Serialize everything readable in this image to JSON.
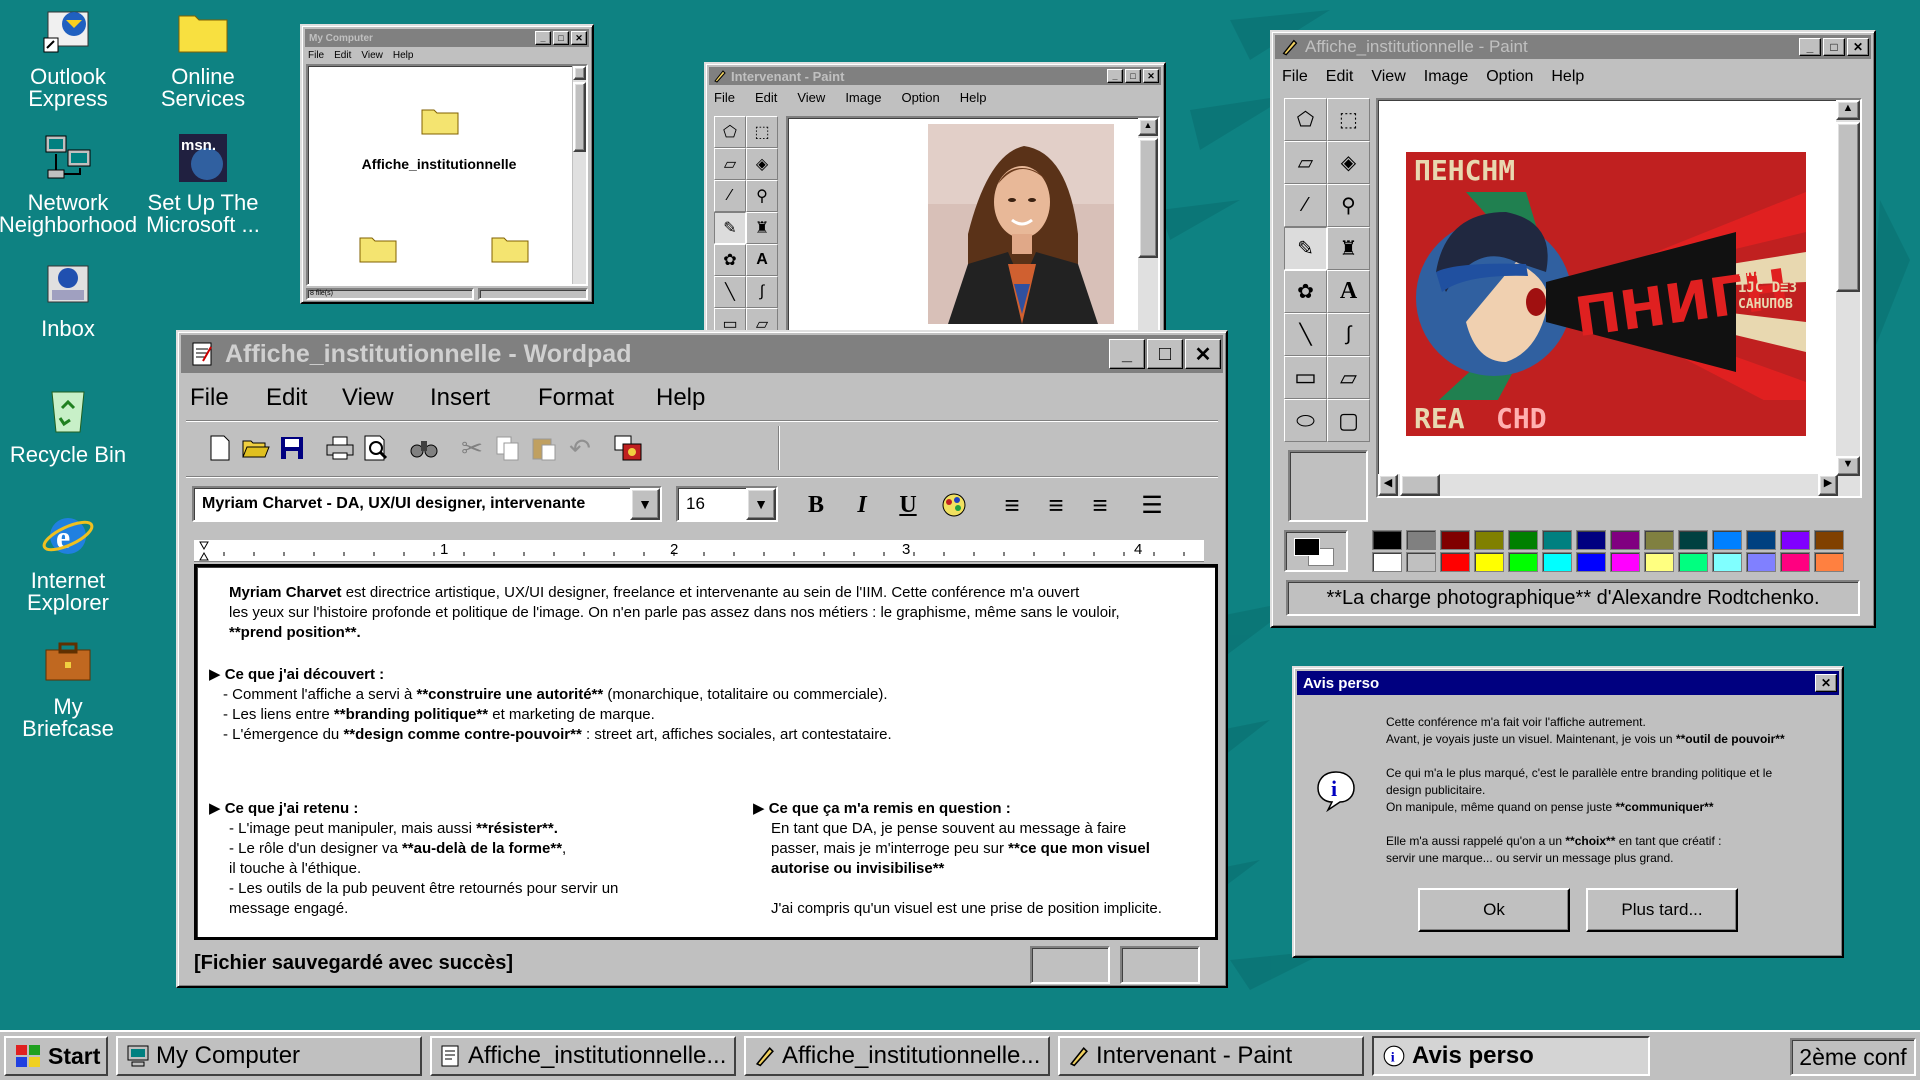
{
  "desktop": {
    "icons": [
      {
        "label": "Outlook\nExpress"
      },
      {
        "label": "Online\nServices"
      },
      {
        "label": "Network\nNeighborhood"
      },
      {
        "label": "Set Up The\nMicrosoft ..."
      },
      {
        "label": "Inbox"
      },
      {
        "label": "Recycle Bin"
      },
      {
        "label": "Internet\nExplorer"
      },
      {
        "label": "My Briefcase"
      }
    ]
  },
  "mycomputer": {
    "title": "My Computer",
    "menu": [
      "File",
      "Edit",
      "View",
      "Help"
    ],
    "folder_label": "Affiche_institutionnelle",
    "status": "8 file(s)"
  },
  "paint_small": {
    "title": "Intervenant - Paint",
    "menu": [
      "File",
      "Edit",
      "View",
      "Image",
      "Option",
      "Help"
    ]
  },
  "paint_big": {
    "title": "Affiche_institutionnelle - Paint",
    "menu": [
      "File",
      "Edit",
      "View",
      "Image",
      "Option",
      "Help"
    ],
    "poster": {
      "top_text": "ПЕНСНМ",
      "top_text2": "СНМ",
      "mega": "ПНИГН",
      "right_text": "INSC TUC\n1JC D≡3\nСАНUПОВ",
      "bottom_text": "REA",
      "bottom_text2": "СНD"
    },
    "caption": "**La charge photographique** d'Alexandre Rodtchenko.",
    "colors_top": [
      "#000000",
      "#808080",
      "#800000",
      "#808000",
      "#008000",
      "#008080",
      "#000080",
      "#800080",
      "#808040",
      "#004040",
      "#0080ff",
      "#004080",
      "#8000ff",
      "#804000"
    ],
    "colors_bottom": [
      "#ffffff",
      "#c0c0c0",
      "#ff0000",
      "#ffff00",
      "#00ff00",
      "#00ffff",
      "#0000ff",
      "#ff00ff",
      "#ffff80",
      "#00ff80",
      "#80ffff",
      "#8080ff",
      "#ff0080",
      "#ff8040"
    ]
  },
  "wordpad": {
    "title": "Affiche_institutionnelle - Wordpad",
    "menu": [
      "File",
      "Edit",
      "View",
      "Insert",
      "Format",
      "Help"
    ],
    "font": "Myriam Charvet - DA, UX/UI designer, intervenante",
    "size": "16",
    "ruler": [
      "1",
      "2",
      "3",
      "4"
    ],
    "status": "[Fichier sauvegardé avec succès]",
    "p1_bold": "Myriam Charvet",
    "p1_a": " est directrice artistique, UX/UI designer, freelance et intervenante au sein de l'IIM. Cette conférence m'a ouvert",
    "p1_b": "les yeux sur l'histoire profonde et politique de l'image. On n'en parle pas assez dans nos métiers :  le graphisme, même sans le vouloir,",
    "p1_c": "**prend position**.",
    "s1_head": "Ce que j'ai découvert :",
    "s1_l1a": "- Comment l'affiche a servi à ",
    "s1_l1b": "**construire une autorité**",
    "s1_l1c": " (monarchique, totalitaire ou commerciale).",
    "s1_l2a": "- Les liens entre ",
    "s1_l2b": "**branding politique**",
    "s1_l2c": " et marketing de marque.",
    "s1_l3a": "- L'émergence du ",
    "s1_l3b": "**design comme contre-pouvoir**",
    "s1_l3c": " : street art, affiches sociales, art contestataire.",
    "s2_head": "Ce que j'ai retenu :",
    "s2_l1a": "- L'image peut manipuler, mais aussi ",
    "s2_l1b": "**résister**.",
    "s2_l2a": "- Le rôle d'un designer va ",
    "s2_l2b": "**au-delà de la forme**",
    ",": ",",
    "s2_l3": "il touche à l'éthique.",
    "s2_l4": "- Les outils de la pub peuvent être retournés pour servir un",
    "s2_l5": "message engagé.",
    "s3_head": "Ce que ça m'a remis en question :",
    "s3_l1": "En tant que DA, je pense souvent au message à faire",
    "s3_l2a": "passer,  mais je m'interroge peu sur ",
    "s3_l2b": "**ce que mon visuel",
    "s3_l3": "autorise ou invisibilise**",
    ".": ".",
    "s3_l4": "J'ai compris qu'un visuel est une prise de position implicite."
  },
  "dialog": {
    "title": "Avis perso",
    "l1": "Cette conférence m'a fait voir l'affiche autrement.",
    "l2a": "Avant, je voyais juste un visuel. Maintenant, je vois un ",
    "l2b": "**outil de pouvoir**",
    ".": ".",
    "l3": "Ce qui m'a le plus marqué, c'est le parallèle entre branding politique et le",
    "l4": "design publicitaire.",
    "l5a": "On manipule, même quand on pense juste ",
    "l5b": "**communiquer**",
    "l6a": "Elle m'a aussi rappelé qu'on a un ",
    "l6b": "**choix**",
    "l6c": " en tant que créatif :",
    "l7": "servir une marque... ou servir un message plus grand.",
    "ok": "Ok",
    "later": "Plus tard..."
  },
  "taskbar": {
    "start": "Start",
    "items": [
      "My Computer",
      "Affiche_institutionnelle...",
      "Affiche_institutionnelle...",
      "Intervenant - Paint",
      "Avis perso"
    ],
    "tray": "2ème conf"
  }
}
